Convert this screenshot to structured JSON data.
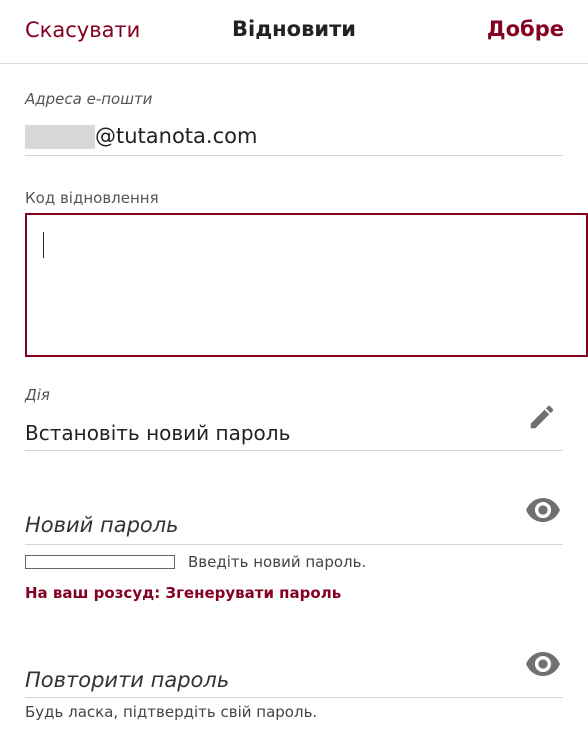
{
  "header": {
    "cancel_label": "Скасувати",
    "title": "Відновити",
    "ok_label": "Добре"
  },
  "email": {
    "label": "Адреса е-пошти",
    "domain": "@tutanota.com"
  },
  "recovery_code": {
    "label": "Код відновлення",
    "value": ""
  },
  "action": {
    "label": "Дія",
    "value": "Встановіть новий пароль",
    "icon": "edit-icon"
  },
  "new_password": {
    "placeholder": "Новий пароль",
    "icon": "eye-icon",
    "strength_percent": 0,
    "strength_hint": "Введіть новий пароль.",
    "generate_link": "На ваш розсуд: Згенерувати пароль"
  },
  "repeat_password": {
    "placeholder": "Повторити пароль",
    "icon": "eye-icon",
    "hint": "Будь ласка, підтвердіть свій пароль."
  },
  "colors": {
    "accent": "#850122",
    "icon": "#707070",
    "divider": "#d4d4d4"
  }
}
